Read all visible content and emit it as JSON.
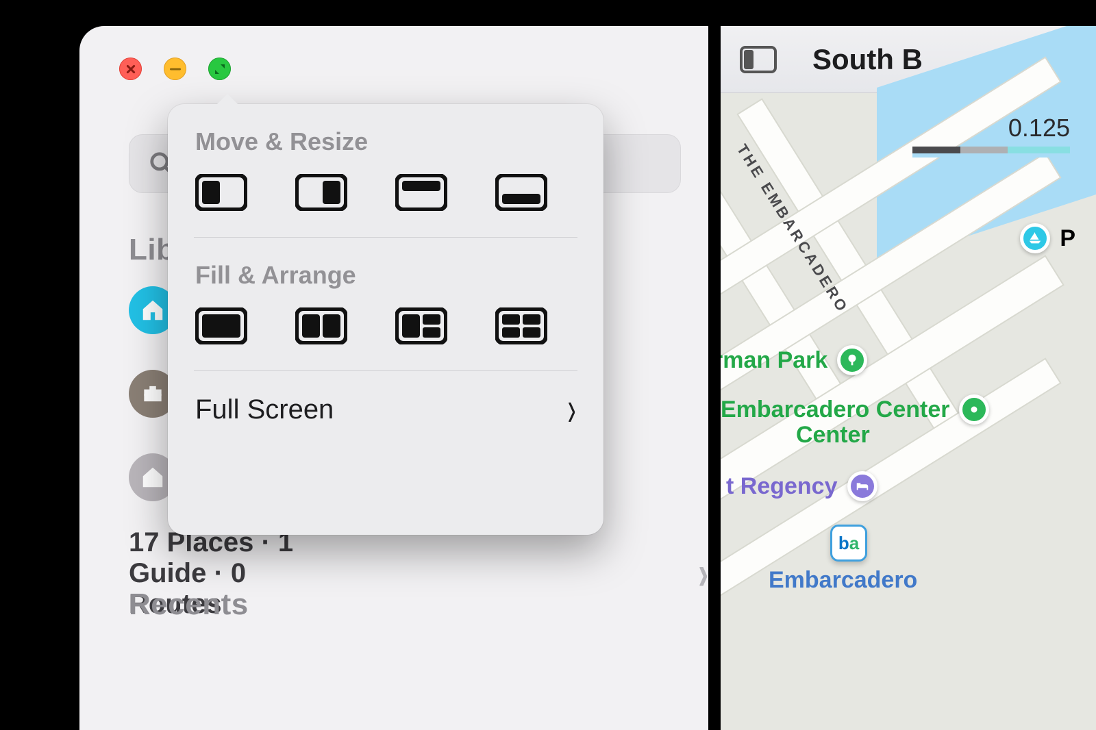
{
  "window": {
    "traffic": {
      "close": "close",
      "minimize": "minimize",
      "fullscreen": "fullscreen"
    }
  },
  "sidebar": {
    "search_placeholder": "",
    "sections": {
      "library": "Library",
      "recents": "Recents"
    },
    "items": [
      {
        "kind": "home"
      },
      {
        "kind": "work"
      },
      {
        "kind": "house"
      }
    ],
    "summary": "17 Places · 1 Guide · 0 Routes"
  },
  "popover": {
    "move_resize_label": "Move & Resize",
    "fill_arrange_label": "Fill & Arrange",
    "full_screen_label": "Full Screen",
    "move_resize_options": [
      "left-half",
      "right-half",
      "top-half",
      "bottom-half"
    ],
    "fill_arrange_options": [
      "fill",
      "two-up",
      "three-up",
      "quad"
    ]
  },
  "map": {
    "toolbar_title": "South B",
    "scale_label": "0.125",
    "street_embarcadero": "THE EMBARCADERO",
    "pois": {
      "herman_park": "rman Park",
      "embarcadero_center": "Embarcadero Center",
      "regency": "t Regency",
      "port_label": "P"
    },
    "bart_station_label": "Embarcadero"
  }
}
